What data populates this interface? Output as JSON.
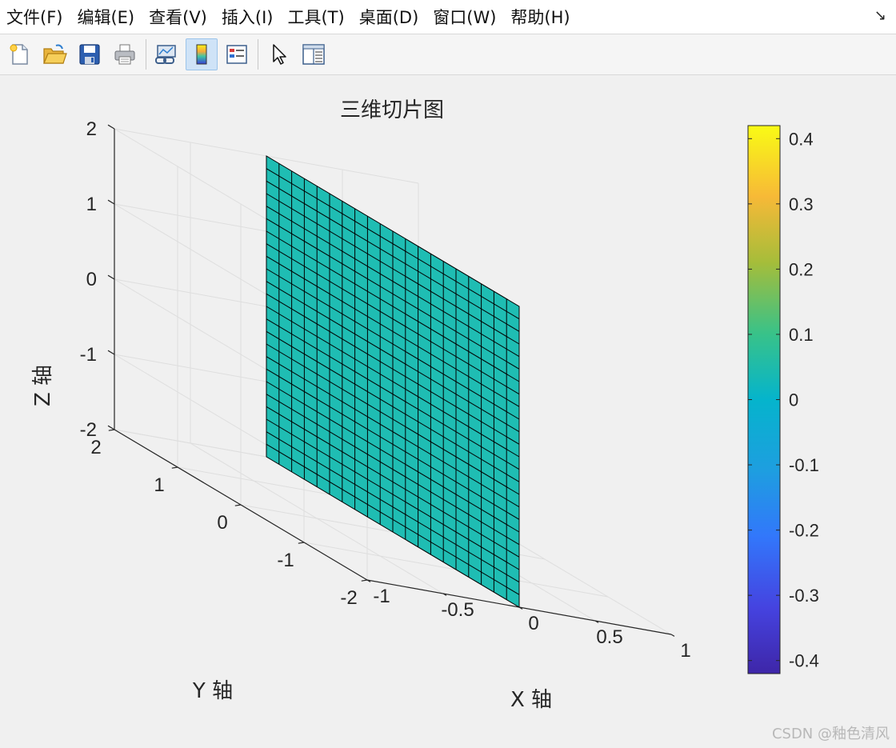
{
  "menu": {
    "items": [
      "文件(F)",
      "编辑(E)",
      "查看(V)",
      "插入(I)",
      "工具(T)",
      "桌面(D)",
      "窗口(W)",
      "帮助(H)"
    ],
    "dock_glyph": "↘"
  },
  "toolbar": {
    "buttons": [
      {
        "icon": "new-figure-icon",
        "active": false
      },
      {
        "icon": "open-file-icon",
        "active": false
      },
      {
        "icon": "save-icon",
        "active": false
      },
      {
        "icon": "print-icon",
        "active": false
      },
      {
        "icon": "link-plot-icon",
        "active": false
      },
      {
        "icon": "colorbar-icon",
        "active": true
      },
      {
        "icon": "legend-icon",
        "active": false
      },
      {
        "icon": "pointer-icon",
        "active": false
      },
      {
        "icon": "property-inspector-icon",
        "active": false
      }
    ]
  },
  "chart_data": {
    "type": "slice3d",
    "title": "三维切片图",
    "xlabel": "X 轴",
    "ylabel": "Y 轴",
    "zlabel": "Z 轴",
    "xlim": [
      -1,
      1
    ],
    "ylim": [
      -2,
      2
    ],
    "zlim": [
      -2,
      2
    ],
    "xticks": [
      -1,
      -0.5,
      0,
      0.5,
      1
    ],
    "yticks": [
      -2,
      -1,
      0,
      1,
      2
    ],
    "zticks": [
      -2,
      -1,
      0,
      1,
      2
    ],
    "slice": {
      "plane": "x",
      "x": 0,
      "y_range": [
        -2,
        2
      ],
      "z_range": [
        -2,
        2
      ],
      "value": 0,
      "grid_cells": [
        20,
        24
      ]
    },
    "grid": true,
    "colormap": "parula",
    "colorbar": {
      "location": "right",
      "clim": [
        -0.42,
        0.42
      ],
      "ticks": [
        -0.4,
        -0.3,
        -0.2,
        -0.1,
        0,
        0.1,
        0.2,
        0.3,
        0.4
      ]
    },
    "face_color": "#1fbdb3",
    "edge_color": "#000000"
  },
  "watermark": "CSDN @釉色清风"
}
